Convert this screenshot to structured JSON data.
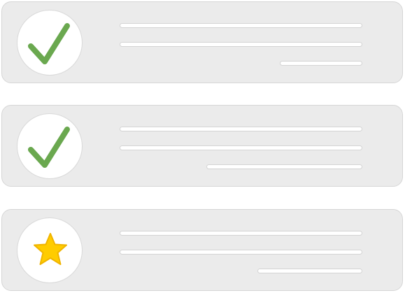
{
  "list": {
    "items": [
      {
        "status_icon": "checkmark-icon",
        "icon_color": "#6aa84f"
      },
      {
        "status_icon": "checkmark-icon",
        "icon_color": "#6aa84f"
      },
      {
        "status_icon": "star-icon",
        "icon_color": "#ffcc00"
      }
    ]
  },
  "colors": {
    "card_background": "#ebebeb",
    "card_border": "#d6d6d6",
    "placeholder_line": "#ffffff",
    "check_green": "#6aa84f",
    "star_yellow": "#ffcc00",
    "star_outline": "#f0b400"
  }
}
